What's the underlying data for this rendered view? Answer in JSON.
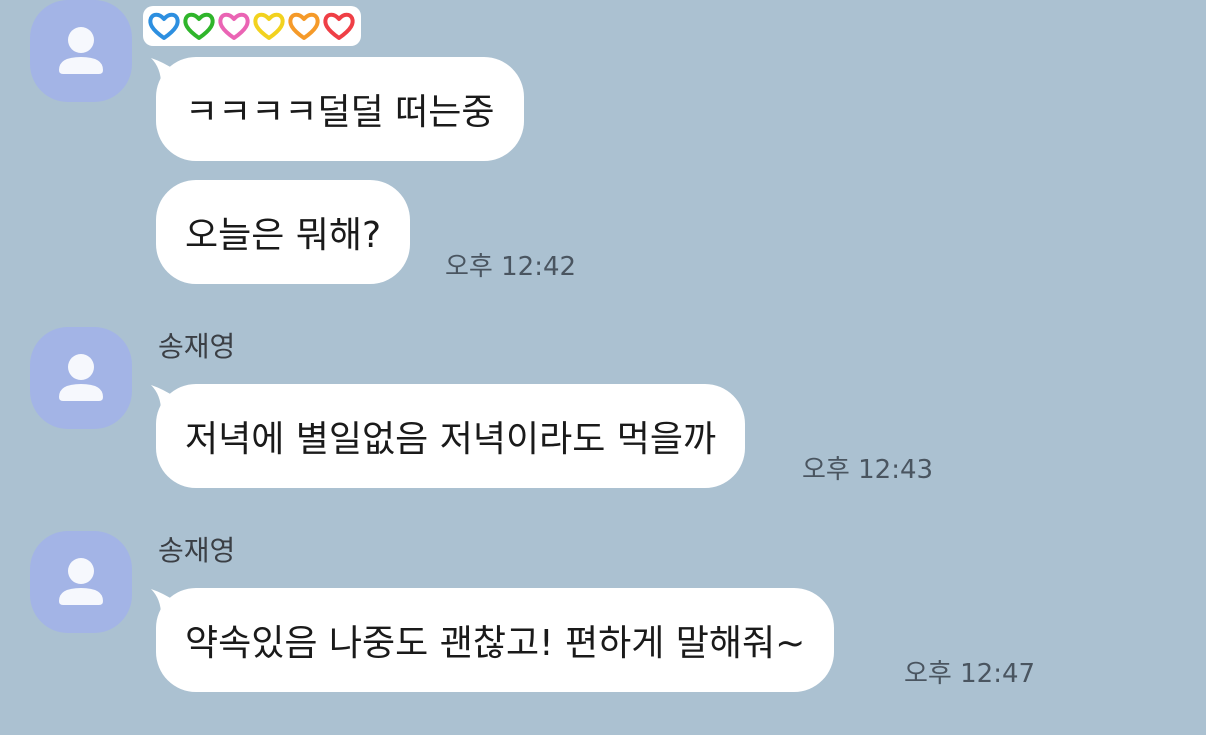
{
  "messages": [
    {
      "sender": "",
      "texts": [
        "ㅋㅋㅋㅋ덜덜 떠는중",
        "오늘은 뭐해?"
      ],
      "time": "오후 12:42"
    },
    {
      "sender": "송재영",
      "texts": [
        "저녁에 별일없음 저녁이라도 먹을까"
      ],
      "time": "오후 12:43"
    },
    {
      "sender": "송재영",
      "texts": [
        "약속있음 나중도 괜찮고! 편하게 말해줘~"
      ],
      "time": "오후 12:47"
    }
  ],
  "icons": {
    "avatar": "default-person-avatar-icon",
    "status": "colored-hearts-sticker"
  },
  "colors": {
    "background": "#abc1d1",
    "bubble": "#ffffff",
    "avatar": "#a3b4e6",
    "hearts": [
      "#2d8fe0",
      "#2fb52b",
      "#ea64b4",
      "#f2d21f",
      "#f59a29",
      "#ef3f46"
    ]
  }
}
